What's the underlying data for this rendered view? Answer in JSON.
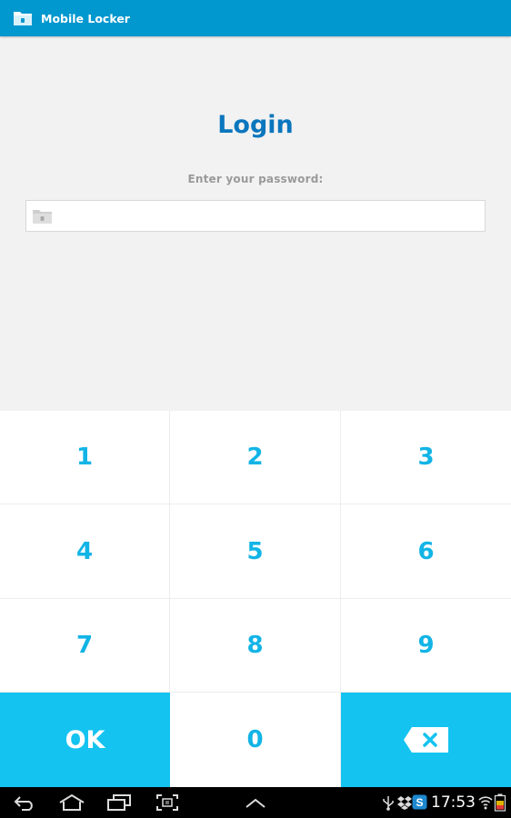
{
  "app": {
    "title": "Mobile Locker",
    "icon": "folder-lock-icon",
    "accent_color": "#0197cf"
  },
  "login": {
    "heading": "Login",
    "prompt": "Enter your password:",
    "password_value": "",
    "field_icon": "folder-lock-icon"
  },
  "keypad": {
    "keys": [
      "1",
      "2",
      "3",
      "4",
      "5",
      "6",
      "7",
      "8",
      "9"
    ],
    "ok_label": "OK",
    "zero_label": "0",
    "backspace_icon": "backspace-icon",
    "key_color": "#12b4e6",
    "accent_key_color": "#14c3f0"
  },
  "system_bar": {
    "time": "17:53",
    "nav_icons": [
      "back-icon",
      "home-icon",
      "recent-apps-icon",
      "screenshot-icon",
      "menu-up-icon"
    ],
    "status_icons": [
      "usb-icon",
      "dropbox-icon",
      "skype-icon",
      "wifi-icon",
      "battery-icon"
    ]
  }
}
